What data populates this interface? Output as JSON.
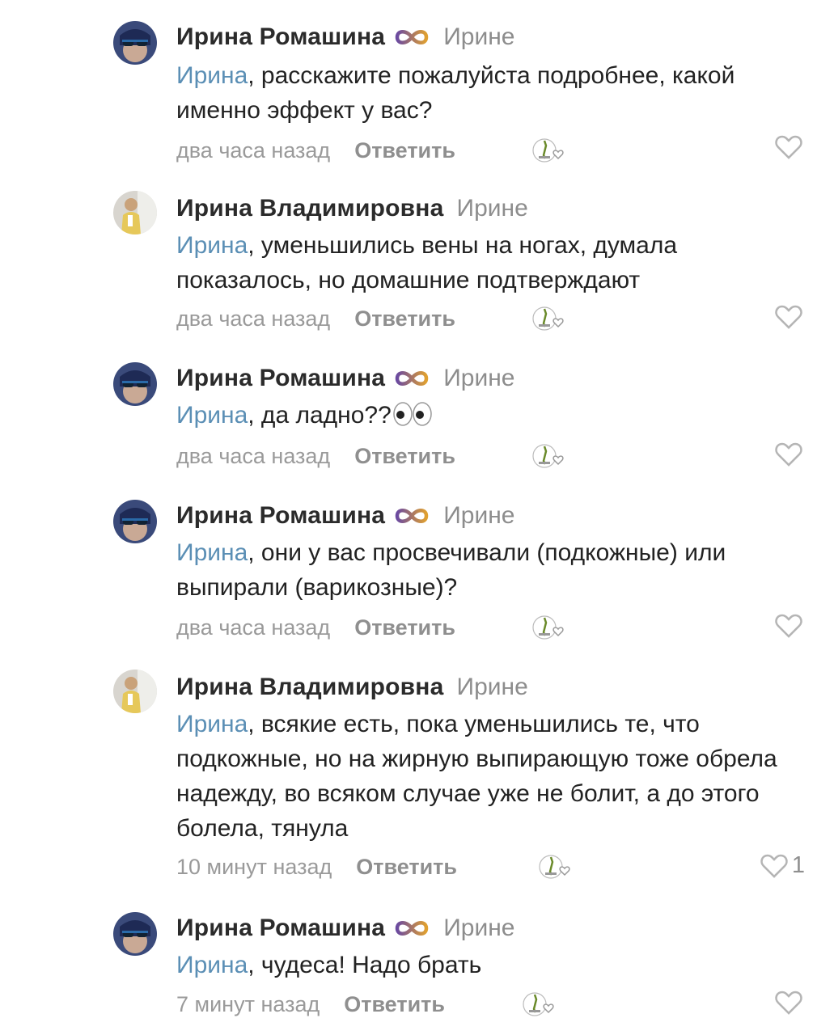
{
  "comments": [
    {
      "author": "Ирина Ромашина",
      "badge_icon": "infinity-icon",
      "reply_to": "Ирине",
      "mention": "Ирина",
      "text": ", расскажите пожалуйста подробнее, какой именно эффект у вас?",
      "time": "два часа назад",
      "reply_label": "Ответить",
      "likes": ""
    },
    {
      "author": "Ирина Владимировна",
      "badge_icon": "",
      "reply_to": "Ирине",
      "mention": "Ирина",
      "text": ",  уменьшились вены на ногах,  думала показалось,  но домашние подтверждают",
      "time": "два часа назад",
      "reply_label": "Ответить",
      "likes": ""
    },
    {
      "author": "Ирина Ромашина",
      "badge_icon": "infinity-icon",
      "reply_to": "Ирине",
      "mention": "Ирина",
      "text": ", да ладно??",
      "emoji": "eyes-emoji",
      "time": "два часа назад",
      "reply_label": "Ответить",
      "likes": ""
    },
    {
      "author": "Ирина Ромашина",
      "badge_icon": "infinity-icon",
      "reply_to": "Ирине",
      "mention": "Ирина",
      "text": ", они у вас просвечивали (подкожные) или выпирали (варикозные)?",
      "time": "два часа назад",
      "reply_label": "Ответить",
      "likes": ""
    },
    {
      "author": "Ирина Владимировна",
      "badge_icon": "",
      "reply_to": "Ирине",
      "mention": "Ирина",
      "text": ", всякие есть,  пока уменьшились те, что подкожные,  но на жирную выпирающую тоже обрела надежду,  во всяком случае уже не болит,  а до этого болела, тянула",
      "time": "10 минут назад",
      "reply_label": "Ответить",
      "likes": "1"
    },
    {
      "author": "Ирина Ромашина",
      "badge_icon": "infinity-icon",
      "reply_to": "Ирине",
      "mention": "Ирина",
      "text": ", чудеса! Надо брать",
      "time": "7 минут назад",
      "reply_label": "Ответить",
      "likes": ""
    }
  ],
  "colors": {
    "mention": "#5b8fb5",
    "meta": "#9a9a9a",
    "like": "#b5b5b5"
  }
}
